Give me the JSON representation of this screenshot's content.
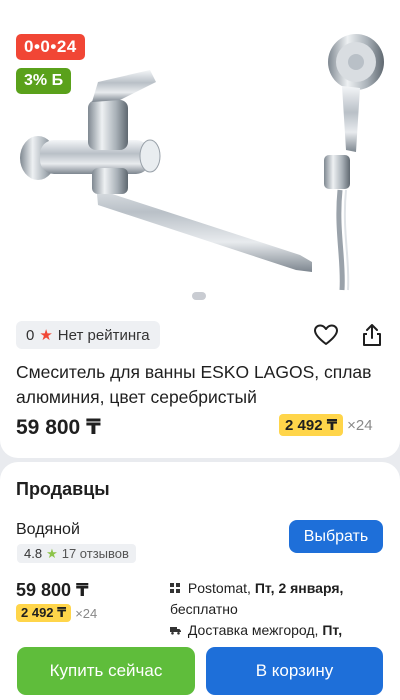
{
  "product": {
    "badges": {
      "timer": "0•0•24",
      "bonus": "3% Б"
    },
    "rating": {
      "count": "0",
      "label": "Нет рейтинга"
    },
    "title": "Смеситель для ванны ESKO LAGOS, сплав алюминия, цвет серебристый",
    "price": "59 800 ₸",
    "installment": {
      "monthly": "2 492 ₸",
      "months": "×24"
    }
  },
  "sellers": {
    "title": "Продавцы",
    "items": [
      {
        "name": "Водяной",
        "rating": "4.8",
        "reviews": "17 отзывов",
        "choose_label": "Выбрать",
        "price": "59 800 ₸",
        "installment": {
          "monthly": "2 492 ₸",
          "months": "×24"
        },
        "delivery": [
          {
            "service": "Postomat,",
            "date": "Пт, 2 января,",
            "note": "бесплатно"
          },
          {
            "service": "Доставка межгород,",
            "date": "Пт,",
            "note": ""
          }
        ]
      }
    ]
  },
  "actions": {
    "buy_now": "Купить сейчас",
    "add_to_cart": "В корзину"
  },
  "colors": {
    "accent": "#1e6fd9",
    "buy": "#5fbd3b",
    "sale": "#f14635",
    "bonus": "#5aa11b",
    "installment": "#ffd54a"
  }
}
